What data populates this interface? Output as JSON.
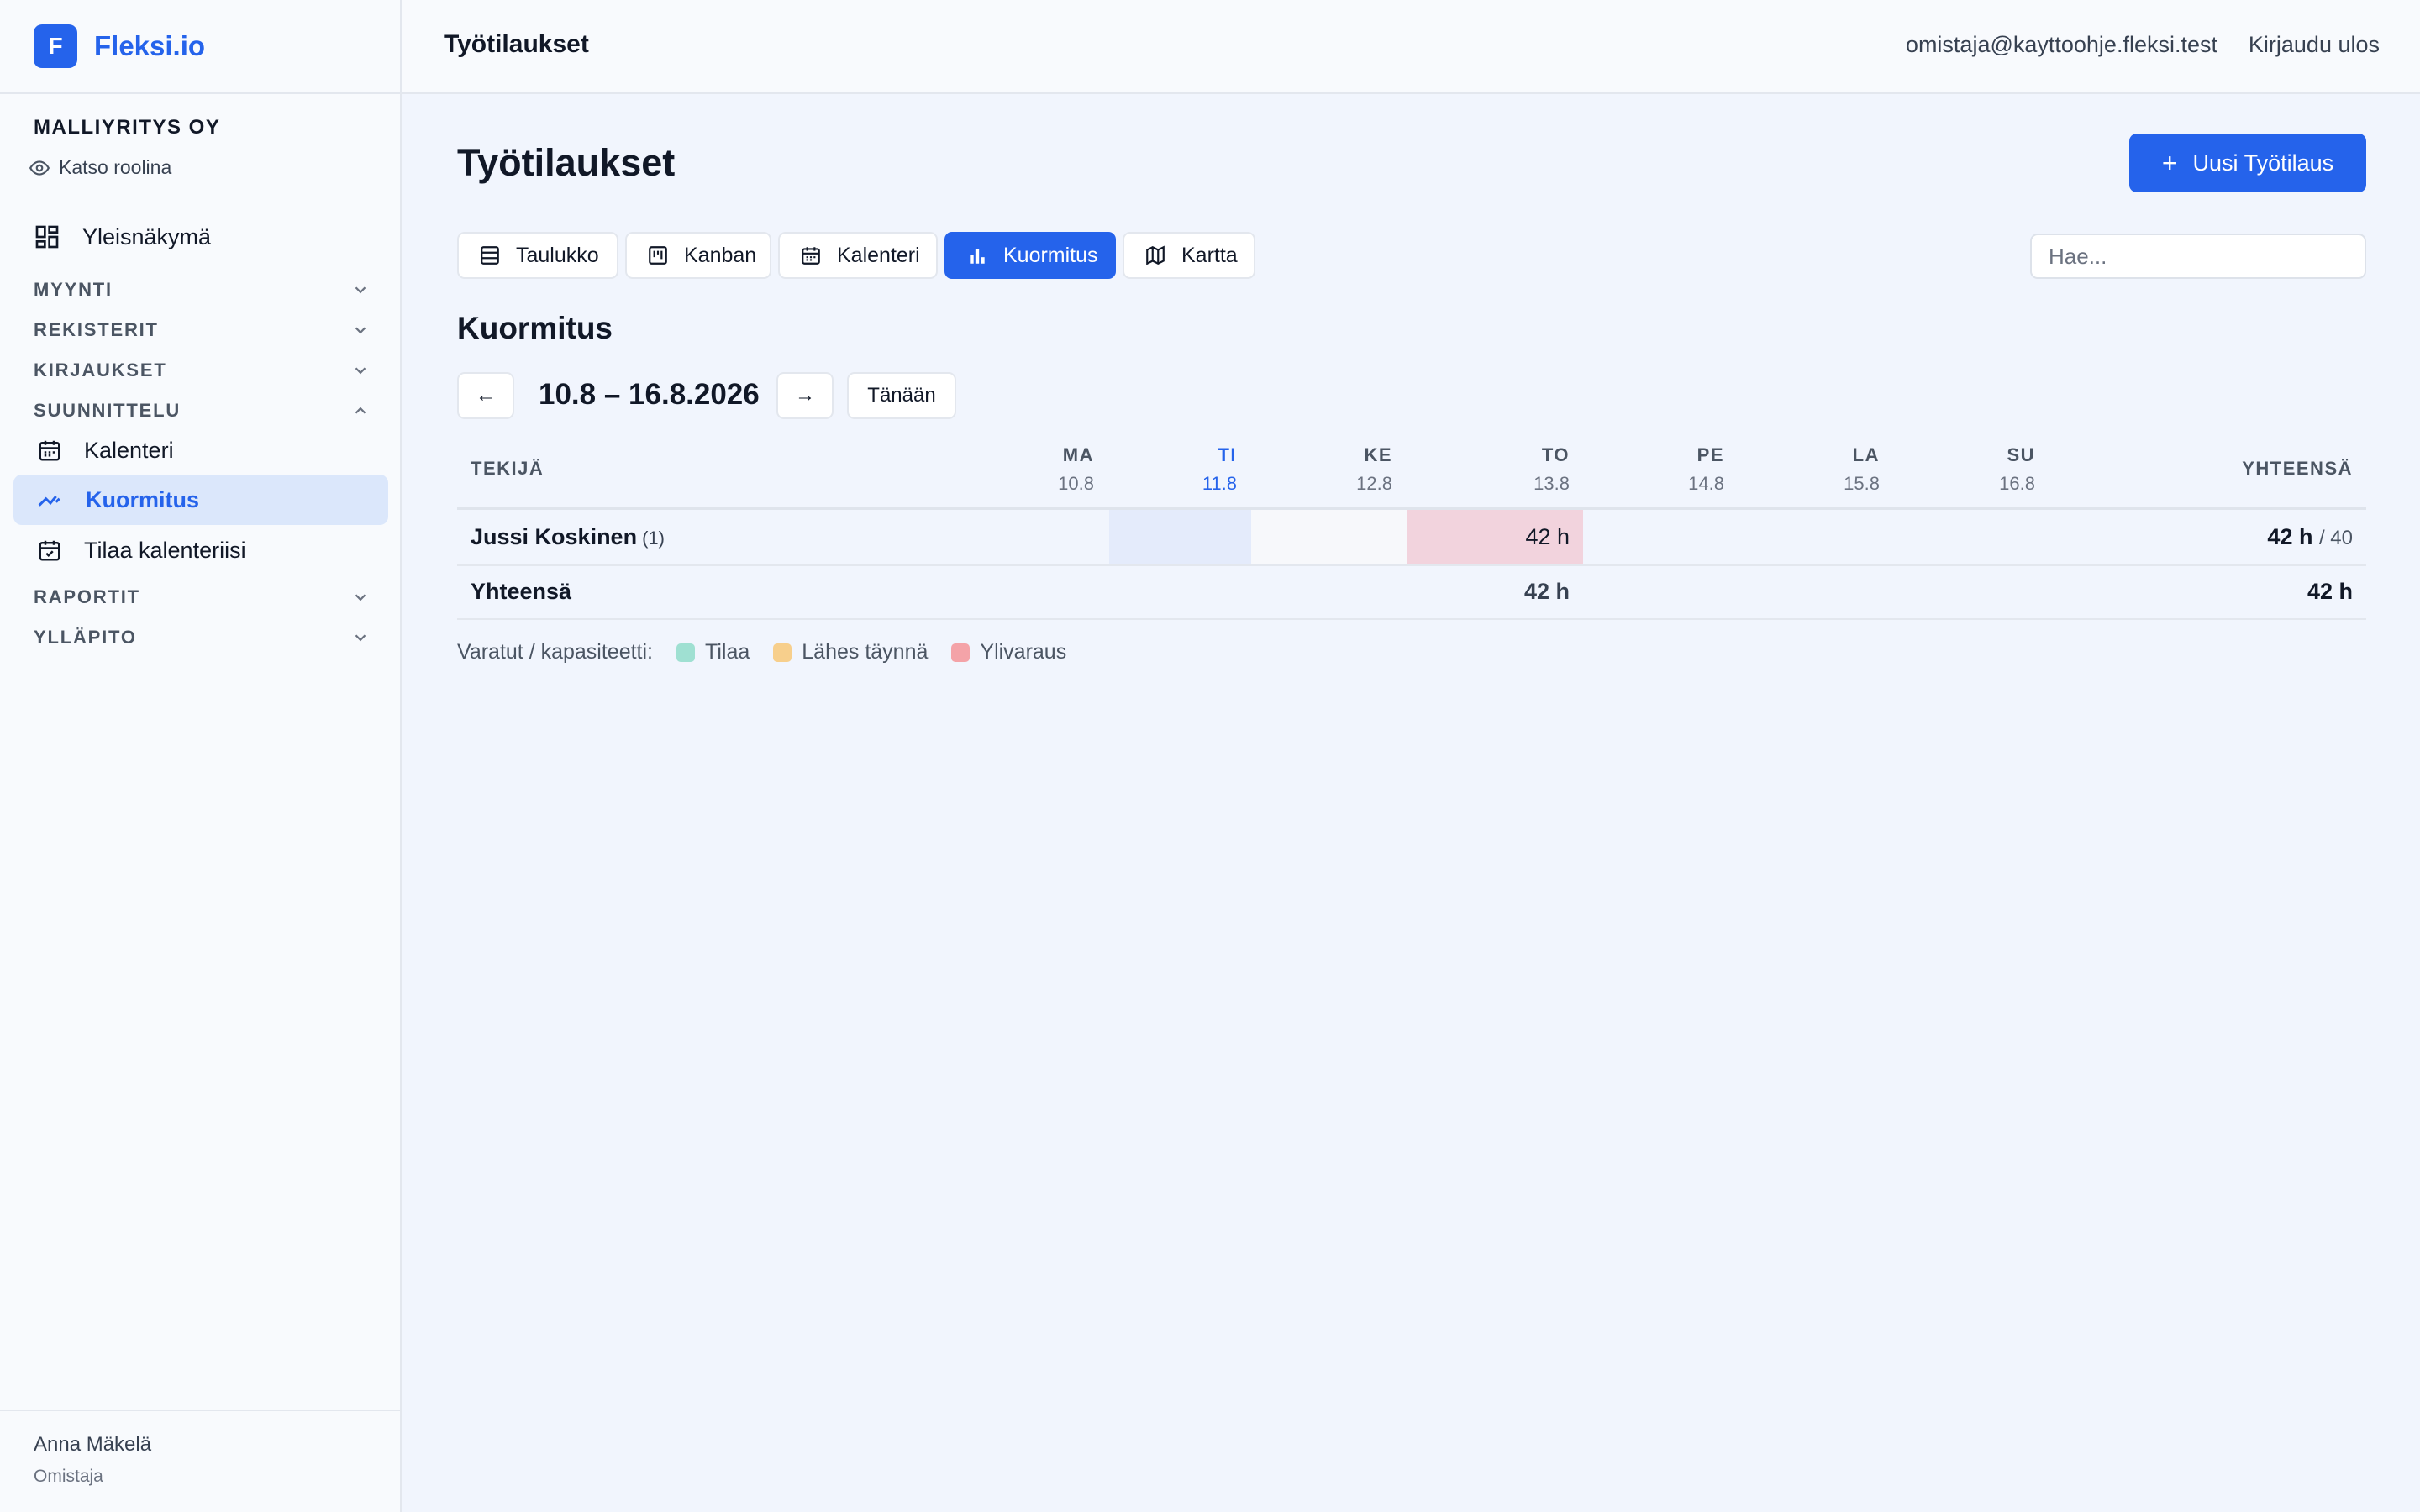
{
  "brand": {
    "logo_letter": "F",
    "name": "Fleksi.io",
    "color": "#2563eb"
  },
  "sidebar": {
    "company": "MALLIYRITYS OY",
    "role_view": "Katso roolina",
    "overview": "Yleisnäkymä",
    "sections": {
      "sales": "MYYNTI",
      "registers": "REKISTERIT",
      "entries": "KIRJAUKSET",
      "planning": "SUUNNITTELU",
      "reports": "RAPORTIT",
      "admin": "YLLÄPITO"
    },
    "planning_items": [
      {
        "label": "Kalenteri",
        "icon": "calendar-icon"
      },
      {
        "label": "Kuormitus",
        "icon": "trend-icon",
        "active": true
      },
      {
        "label": "Tilaa kalenteriisi",
        "icon": "calendar-check-icon"
      }
    ],
    "user": {
      "name": "Anna Mäkelä",
      "role": "Omistaja"
    }
  },
  "header": {
    "title": "Työtilaukset",
    "email": "omistaja@kayttoohje.fleksi.test",
    "logout": "Kirjaudu ulos"
  },
  "main": {
    "title": "Työtilaukset",
    "new_button": "Uusi Työtilaus",
    "tabs": [
      {
        "label": "Taulukko",
        "icon": "table-icon"
      },
      {
        "label": "Kanban",
        "icon": "kanban-icon"
      },
      {
        "label": "Kalenteri",
        "icon": "calendar-icon"
      },
      {
        "label": "Kuormitus",
        "icon": "bar-chart-icon",
        "active": true
      },
      {
        "label": "Kartta",
        "icon": "map-icon"
      }
    ],
    "search_placeholder": "Hae...",
    "section_title": "Kuormitus",
    "prev": "←",
    "next": "→",
    "range": "10.8 – 16.8.2026",
    "today_button": "Tänään"
  },
  "table": {
    "worker_header": "TEKIJÄ",
    "total_header": "YHTEENSÄ",
    "days": [
      {
        "label": "MA",
        "date": "10.8"
      },
      {
        "label": "TI",
        "date": "11.8",
        "today": true
      },
      {
        "label": "KE",
        "date": "12.8"
      },
      {
        "label": "TO",
        "date": "13.8"
      },
      {
        "label": "PE",
        "date": "14.8"
      },
      {
        "label": "LA",
        "date": "15.8"
      },
      {
        "label": "SU",
        "date": "16.8"
      }
    ],
    "rows": [
      {
        "name": "Jussi Koskinen",
        "count": "(1)",
        "thursday": "42 h",
        "total": "42 h",
        "capacity": "/ 40",
        "status": "Ylivaraus"
      }
    ],
    "sum_row": {
      "label": "Yhteensä",
      "thursday": "42 h",
      "total": "42 h"
    }
  },
  "legend": {
    "title": "Varatut / kapasiteetti:",
    "items": [
      {
        "label": "Tilaa",
        "color": "#9fe0d2"
      },
      {
        "label": "Lähes täynnä",
        "color": "#f7cf8c"
      },
      {
        "label": "Ylivaraus",
        "color": "#f4a3a8"
      }
    ]
  }
}
